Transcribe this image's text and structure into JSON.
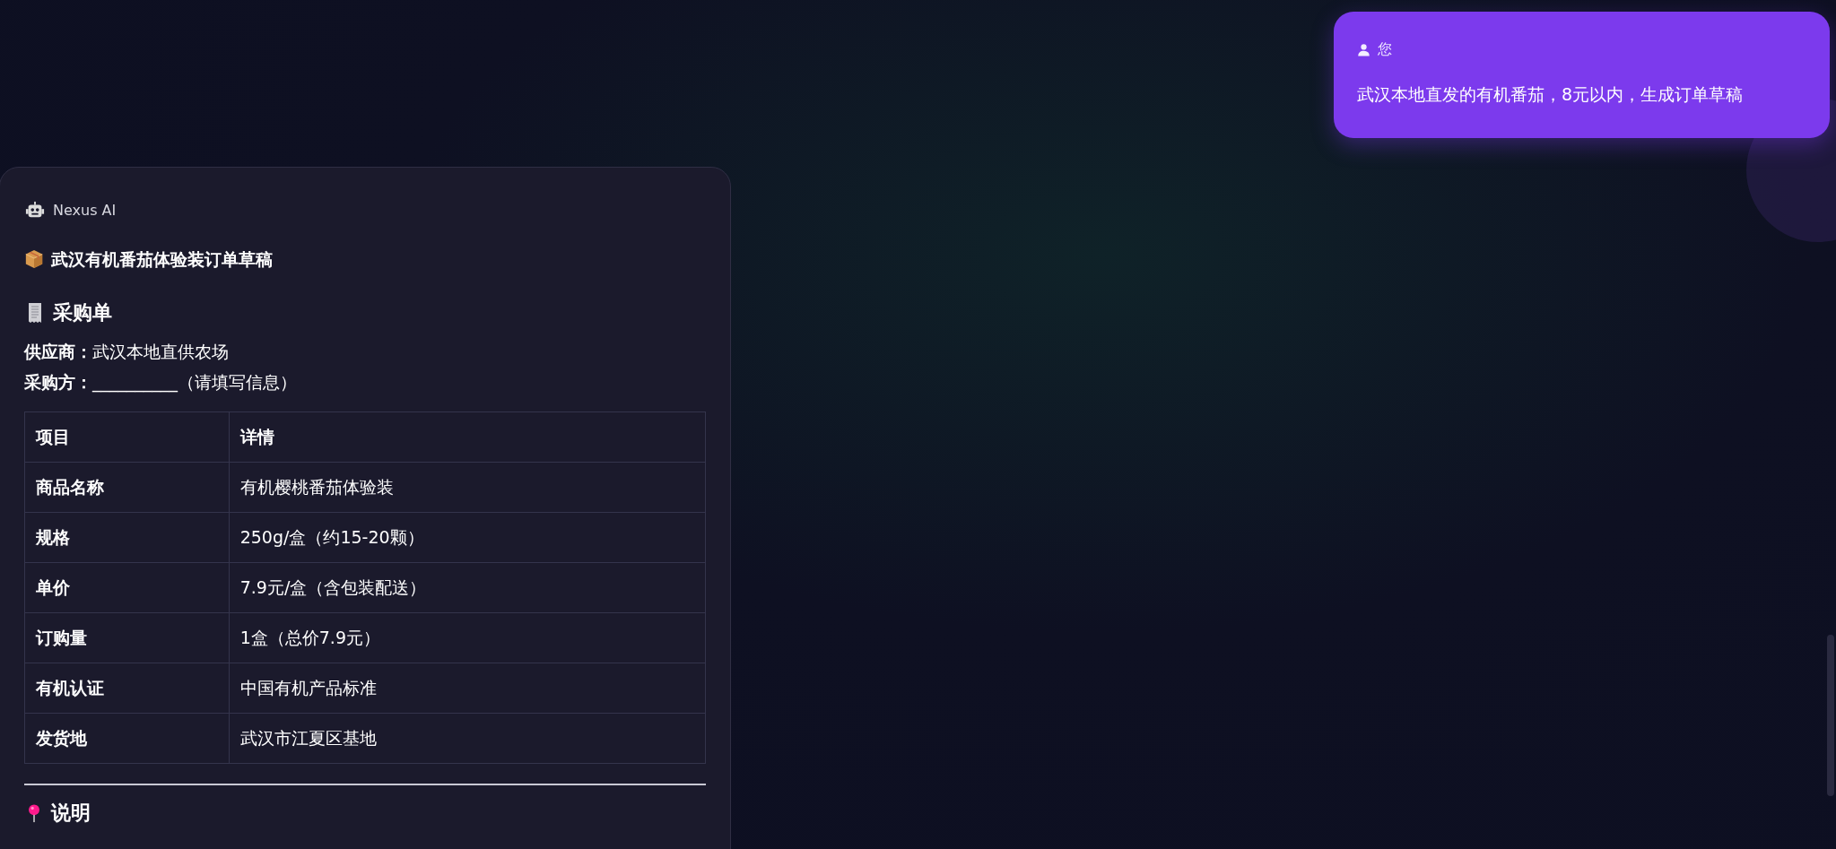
{
  "messages": [
    {
      "kind": "user",
      "sender": "您",
      "text": "武汉本地直发的有机番茄，8元以内，生成订单草稿"
    },
    {
      "kind": "assistant",
      "sender": "Nexus AI",
      "title": "武汉有机番茄体验装订单草稿",
      "section_heading": "采购单",
      "fields": [
        {
          "label": "供应商：",
          "value": "武汉本地直供农场"
        },
        {
          "label": "采购方：",
          "value": "__________（请填写信息）"
        }
      ],
      "table": {
        "columns": [
          "项目",
          "详情"
        ],
        "rows": [
          [
            "商品名称",
            "有机樱桃番茄体验装"
          ],
          [
            "规格",
            "250g/盒（约15-20颗）"
          ],
          [
            "单价",
            "7.9元/盒（含包装配送）"
          ],
          [
            "订购量",
            "1盒（总价7.9元）"
          ],
          [
            "有机认证",
            "中国有机产品标准"
          ],
          [
            "发货地",
            "武汉市江夏区基地"
          ]
        ]
      },
      "next_heading": "说明"
    }
  ]
}
